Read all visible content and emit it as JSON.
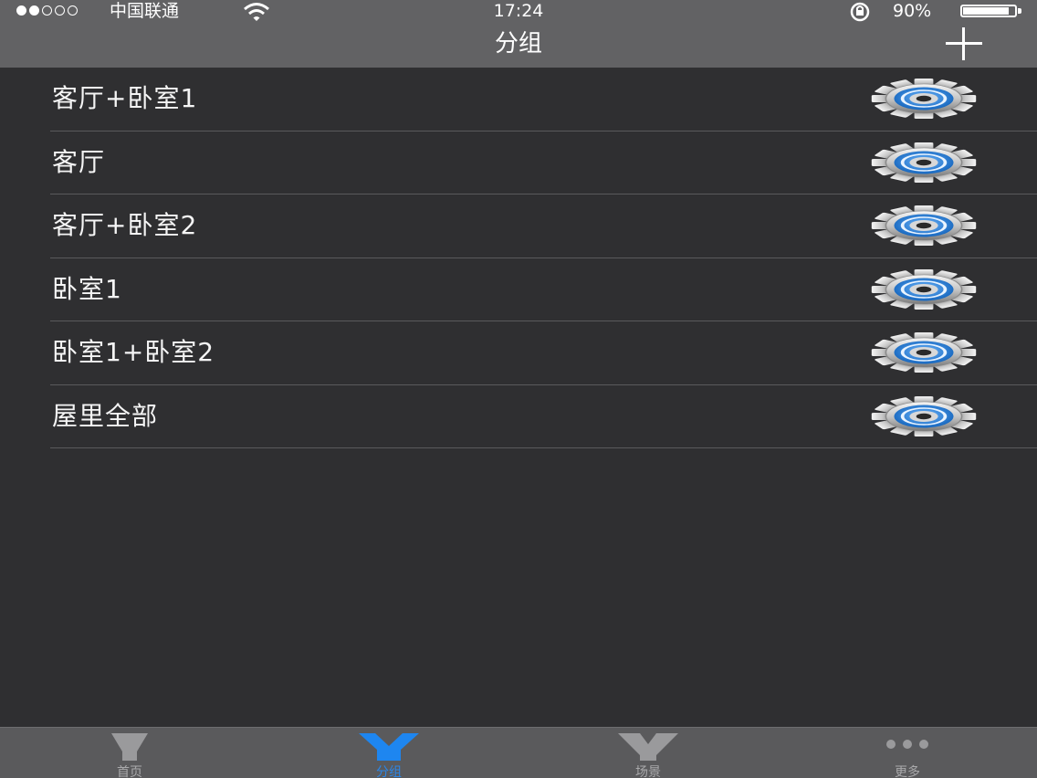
{
  "status_bar": {
    "carrier": "中国联通",
    "time": "17:24",
    "battery_percent": "90%",
    "battery_level": 0.9,
    "signal_strength": 2,
    "signal_max": 5
  },
  "nav": {
    "title": "分组",
    "add_icon": "plus-icon"
  },
  "groups": [
    {
      "name": "客厅+卧室1",
      "icon": "gear-icon"
    },
    {
      "name": "客厅",
      "icon": "gear-icon"
    },
    {
      "name": "客厅+卧室2",
      "icon": "gear-icon"
    },
    {
      "name": "卧室1",
      "icon": "gear-icon"
    },
    {
      "name": "卧室1+卧室2",
      "icon": "gear-icon"
    },
    {
      "name": "屋里全部",
      "icon": "gear-icon"
    }
  ],
  "tabs": [
    {
      "label": "首页",
      "icon": "bulb-icon",
      "active": false
    },
    {
      "label": "分组",
      "icon": "group-icon",
      "active": true
    },
    {
      "label": "场景",
      "icon": "scene-icon",
      "active": false
    },
    {
      "label": "更多",
      "icon": "more-icon",
      "active": false
    }
  ],
  "colors": {
    "background": "#2f2f31",
    "nav_bar": "#626264",
    "tab_bar": "#5a5a5c",
    "accent": "#2c86e6",
    "gear_blue": "#1f78d6"
  }
}
